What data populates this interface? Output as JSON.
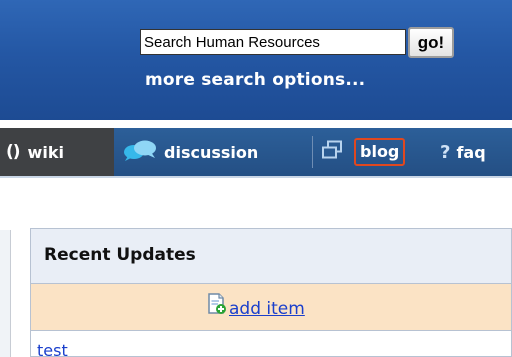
{
  "search": {
    "value": "Search Human Resources",
    "go_label": "go!",
    "more_options_label": "more search options..."
  },
  "tabs": [
    {
      "label": "wiki",
      "icon": "code-brackets-icon"
    },
    {
      "label": "discussion",
      "icon": "chat-bubbles-icon"
    },
    {
      "label": "blog",
      "icon": "windows-icon"
    },
    {
      "label": "faq",
      "icon": "question-icon"
    }
  ],
  "recent_updates": {
    "title": "Recent Updates",
    "add_item_label": "add item",
    "items": [
      "test"
    ]
  },
  "colors": {
    "header_blue": "#2457a4",
    "tab_blue": "#2c5f99",
    "active_tab": "#3f4144",
    "highlight_orange": "#e0481f",
    "add_row": "#fbe3c5",
    "link": "#1a3fcc"
  }
}
